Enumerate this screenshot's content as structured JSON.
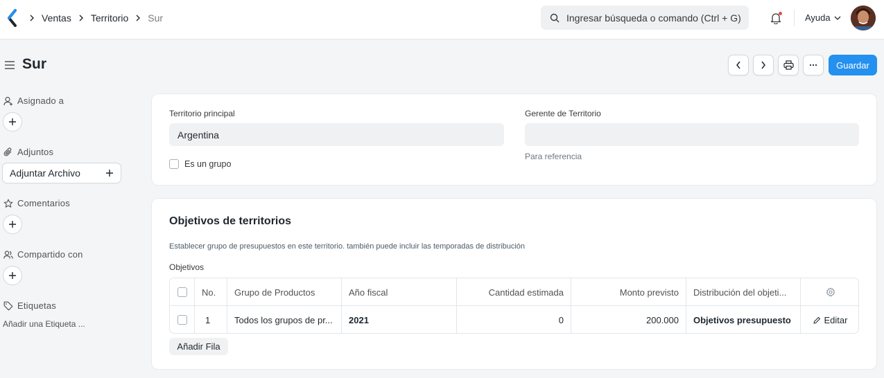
{
  "navbar": {
    "breadcrumbs": [
      "Ventas",
      "Territorio",
      "Sur"
    ],
    "search_placeholder": "Ingresar búsqueda o comando (Ctrl + G)",
    "help_label": "Ayuda"
  },
  "page": {
    "title": "Sur",
    "save_label": "Guardar"
  },
  "sidebar": {
    "assigned_label": "Asignado a",
    "attachments_label": "Adjuntos",
    "attach_button": "Adjuntar Archivo",
    "comments_label": "Comentarios",
    "shared_label": "Compartido con",
    "tags_label": "Etiquetas",
    "add_tag": "Añadir una Etiqueta ..."
  },
  "form": {
    "parent_territory_label": "Territorio principal",
    "parent_territory_value": "Argentina",
    "is_group_label": "Es un grupo",
    "manager_label": "Gerente de Territorio",
    "manager_value": "",
    "manager_help": "Para referencia"
  },
  "targets": {
    "title": "Objetivos de territorios",
    "description": "Establecer grupo de presupuestos en este territorio. también puede incluir las temporadas de distribución",
    "grid_label": "Objetivos",
    "columns": [
      "No.",
      "Grupo de Productos",
      "Año fiscal",
      "Cantidad estimada",
      "Monto previsto",
      "Distribución del objeti..."
    ],
    "rows": [
      {
        "no": "1",
        "item_group": "Todos los grupos de pr...",
        "fiscal_year": "2021",
        "target_qty": "0",
        "target_amount": "200.000",
        "distribution": "Objetivos presupuesto",
        "edit_label": "Editar"
      }
    ],
    "add_row_label": "Añadir Fila"
  },
  "colors": {
    "primary": "#2490ef",
    "background": "#f4f5f6"
  }
}
